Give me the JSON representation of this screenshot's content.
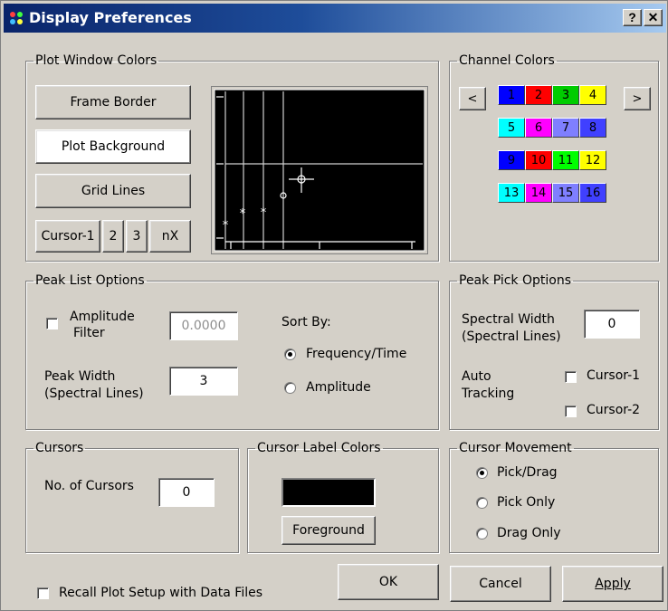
{
  "window": {
    "title": "Display Preferences",
    "help_label": "?",
    "close_label": "✕"
  },
  "plot_window_colors": {
    "legend": "Plot Window Colors",
    "frame_border": "Frame Border",
    "plot_background": "Plot Background",
    "grid_lines": "Grid Lines",
    "cursor_buttons": [
      "Cursor-1",
      "2",
      "3",
      "nX"
    ]
  },
  "channel_colors": {
    "legend": "Channel Colors",
    "prev_label": "<",
    "next_label": ">",
    "channels": [
      {
        "label": "1",
        "color": "#0000ff",
        "text": "#000000"
      },
      {
        "label": "2",
        "color": "#ff0000",
        "text": "#000000"
      },
      {
        "label": "3",
        "color": "#00cc00",
        "text": "#000000"
      },
      {
        "label": "4",
        "color": "#ffff00",
        "text": "#000000"
      },
      {
        "label": "5",
        "color": "#00ffff",
        "text": "#000000"
      },
      {
        "label": "6",
        "color": "#ff00ff",
        "text": "#000000"
      },
      {
        "label": "7",
        "color": "#7f7fff",
        "text": "#000000"
      },
      {
        "label": "8",
        "color": "#4040ff",
        "text": "#000000"
      },
      {
        "label": "9",
        "color": "#0000ff",
        "text": "#000000"
      },
      {
        "label": "10",
        "color": "#ff0000",
        "text": "#000000"
      },
      {
        "label": "11",
        "color": "#00ff00",
        "text": "#000000"
      },
      {
        "label": "12",
        "color": "#ffff00",
        "text": "#000000"
      },
      {
        "label": "13",
        "color": "#00ffff",
        "text": "#000000"
      },
      {
        "label": "14",
        "color": "#ff00ff",
        "text": "#000000"
      },
      {
        "label": "15",
        "color": "#7f7fff",
        "text": "#000000"
      },
      {
        "label": "16",
        "color": "#4040ff",
        "text": "#000000"
      }
    ]
  },
  "peak_list": {
    "legend": "Peak List Options",
    "amplitude_filter_label_1": "Amplitude",
    "amplitude_filter_label_2": "Filter",
    "amplitude_filter_value": "0.0000",
    "amplitude_filter_checked": false,
    "peak_width_label_1": "Peak Width",
    "peak_width_label_2": "(Spectral Lines)",
    "peak_width_value": "3",
    "sort_by_label": "Sort By:",
    "sort_options": [
      "Frequency/Time",
      "Amplitude"
    ],
    "sort_selected": "Frequency/Time"
  },
  "peak_pick": {
    "legend": "Peak Pick Options",
    "spectral_width_label_1": "Spectral Width",
    "spectral_width_label_2": "(Spectral Lines)",
    "spectral_width_value": "0",
    "auto_tracking_label_1": "Auto",
    "auto_tracking_label_2": "Tracking",
    "cursor1_label": "Cursor-1",
    "cursor2_label": "Cursor-2"
  },
  "cursors": {
    "legend": "Cursors",
    "count_label": "No. of Cursors",
    "count_value": "0"
  },
  "cursor_label_colors": {
    "legend": "Cursor Label Colors",
    "swatch_color": "#000000",
    "foreground_label": "Foreground"
  },
  "cursor_movement": {
    "legend": "Cursor Movement",
    "options": [
      "Pick/Drag",
      "Pick Only",
      "Drag Only"
    ],
    "selected": "Pick/Drag"
  },
  "footer": {
    "recall_label": "Recall Plot Setup with Data Files",
    "ok_label": "OK",
    "cancel_label": "Cancel",
    "apply_label": "Apply"
  }
}
